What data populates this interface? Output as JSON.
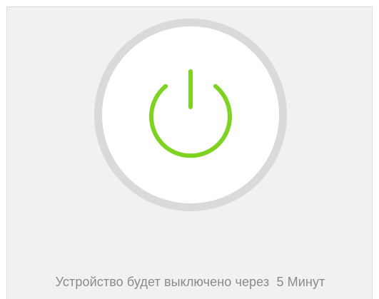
{
  "power_button": {
    "icon": "power-icon",
    "ring_color": "#dadada",
    "fill_color": "#ffffff",
    "icon_color": "#7ed321"
  },
  "shutdown_message": {
    "text": "Устройство будет выключено через",
    "value": "5",
    "unit": "Минут"
  },
  "colors": {
    "background": "#f1f1f1",
    "text": "#8a8a8a"
  }
}
